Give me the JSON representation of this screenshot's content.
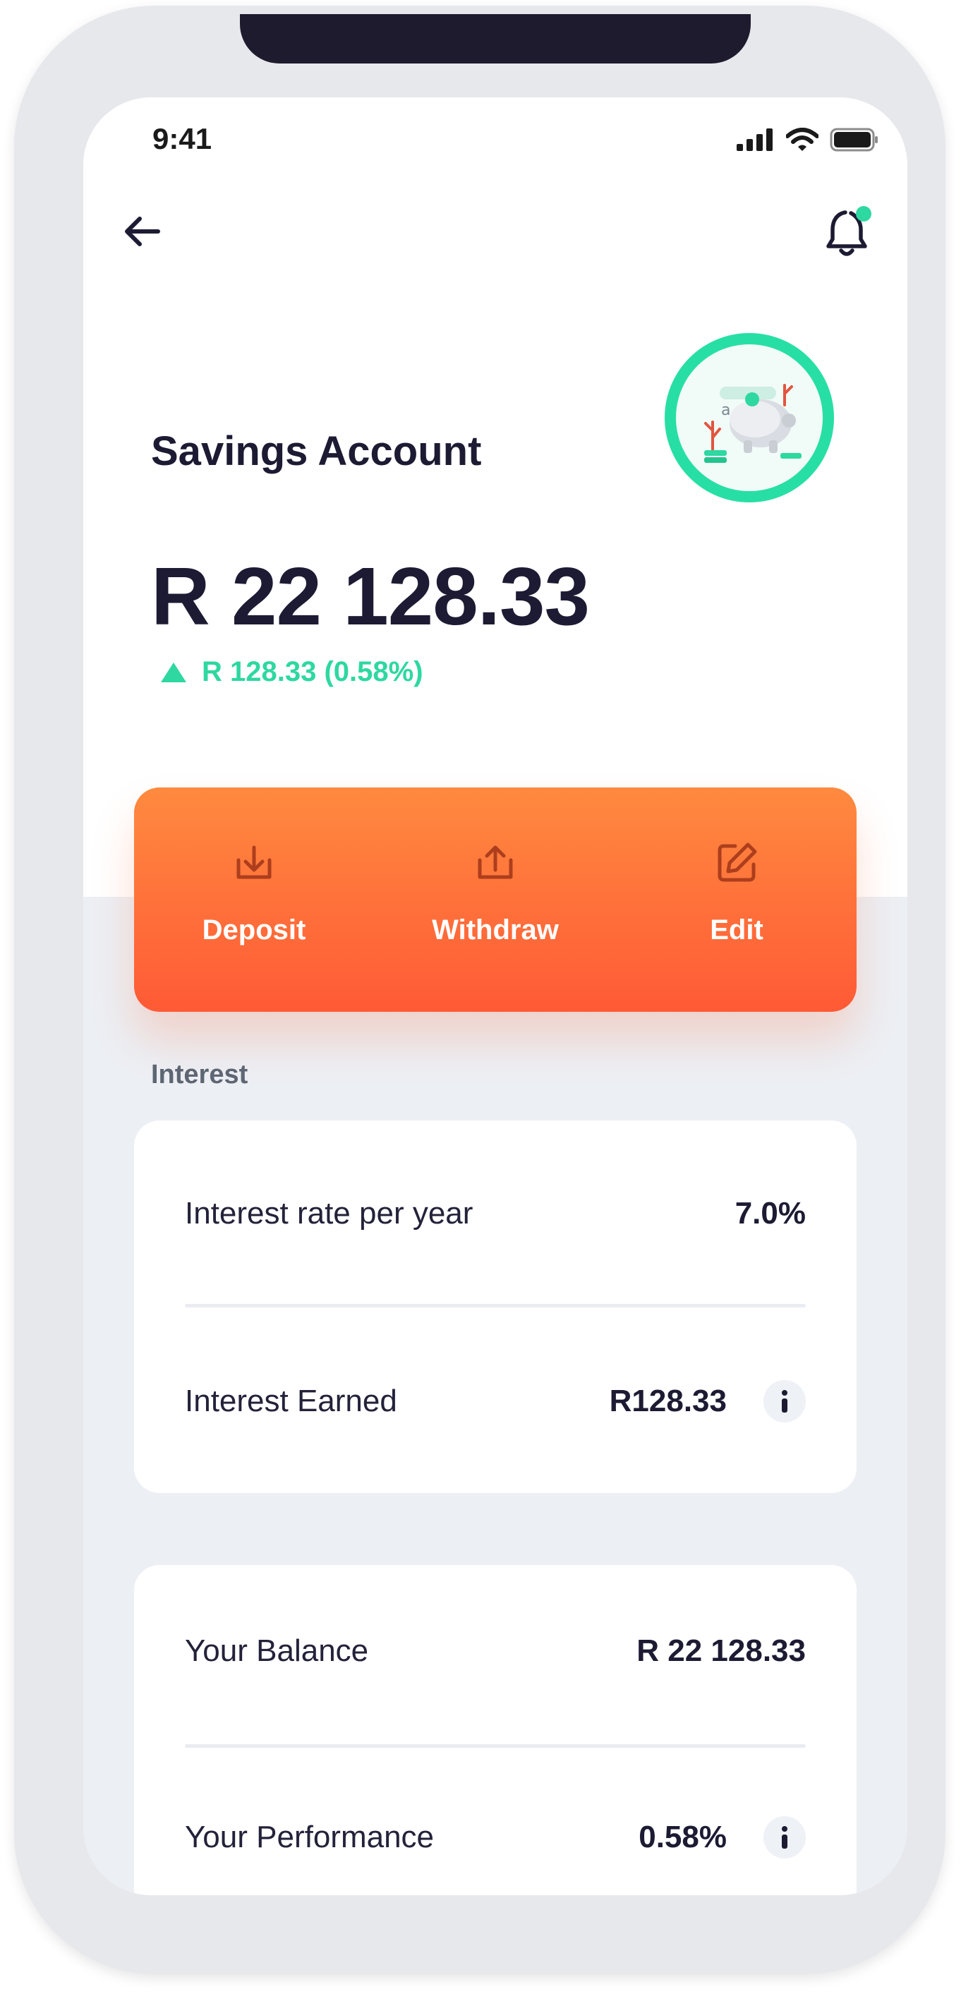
{
  "status_bar": {
    "time": "9:41"
  },
  "header": {
    "back_icon": "arrow-left-icon",
    "bell_icon": "bell-icon",
    "notification_dot_color": "#2ed8a0"
  },
  "account": {
    "title": "Savings Account",
    "balance": "R 22 128.33",
    "change": "R 128.33 (0.58%)",
    "change_direction": "up",
    "accent_color": "#2ed8a0"
  },
  "actions": [
    {
      "label": "Deposit",
      "icon": "deposit-icon"
    },
    {
      "label": "Withdraw",
      "icon": "withdraw-icon"
    },
    {
      "label": "Edit",
      "icon": "edit-icon"
    }
  ],
  "interest": {
    "section_label": "Interest",
    "rate_label": "Interest rate per year",
    "rate_value": "7.0%",
    "earned_label": "Interest Earned",
    "earned_value": "R128.33"
  },
  "summary": {
    "balance_label": "Your Balance",
    "balance_value": "R 22 128.33",
    "performance_label": "Your Performance",
    "performance_value": "0.58%"
  },
  "colors": {
    "brand_orange_top": "#ff8a3f",
    "brand_orange_bottom": "#ff5a36",
    "teal": "#27dfa4",
    "text_dark": "#1d1b33"
  }
}
